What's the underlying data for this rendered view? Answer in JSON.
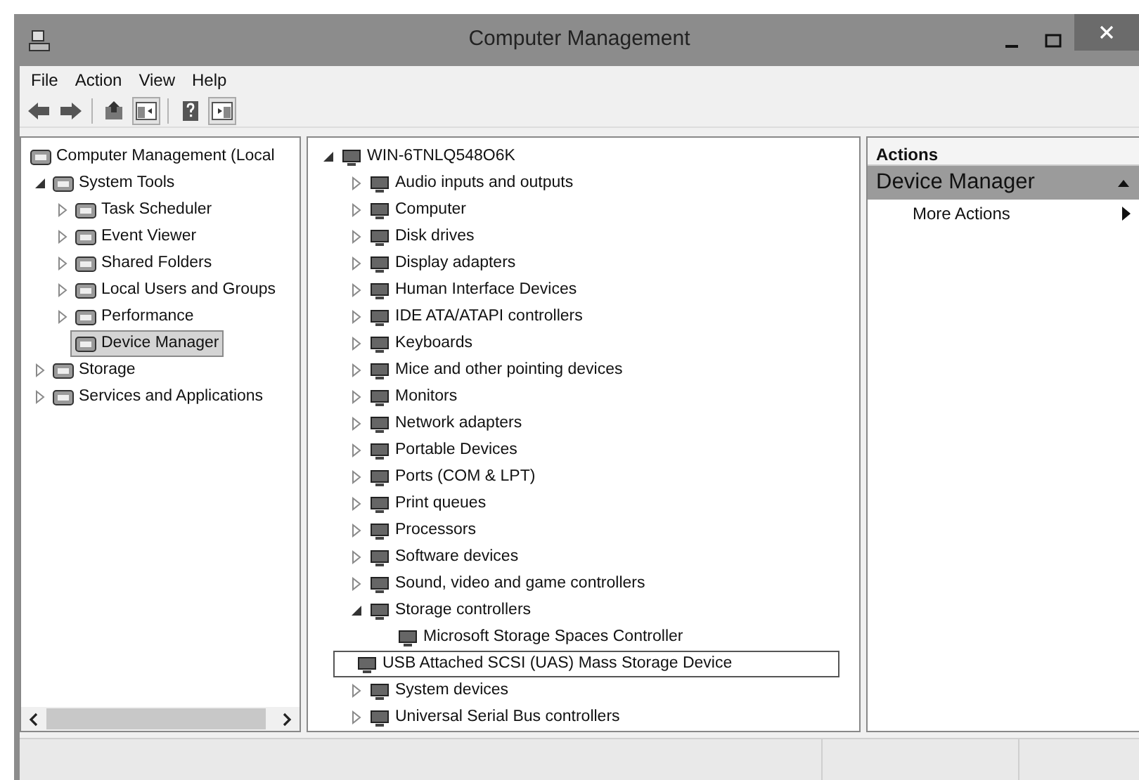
{
  "window": {
    "title": "Computer Management"
  },
  "menu": [
    "File",
    "Action",
    "View",
    "Help"
  ],
  "toolbar": [
    {
      "kind": "back",
      "pressed": false
    },
    {
      "kind": "forward",
      "pressed": false
    },
    {
      "kind": "separator"
    },
    {
      "kind": "up",
      "pressed": false
    },
    {
      "kind": "console_tree",
      "pressed": true
    },
    {
      "kind": "separator"
    },
    {
      "kind": "help",
      "pressed": false
    },
    {
      "kind": "action_pane",
      "pressed": true
    }
  ],
  "console_tree": {
    "items": [
      {
        "label": "Computer Management (Local",
        "selected": false,
        "children": [
          {
            "label": "System Tools",
            "expanded": true,
            "selected": false,
            "children": [
              {
                "label": "Task Scheduler",
                "expanded": false,
                "selected": false
              },
              {
                "label": "Event Viewer",
                "expanded": false,
                "selected": false
              },
              {
                "label": "Shared Folders",
                "expanded": false,
                "selected": false
              },
              {
                "label": "Local Users and Groups",
                "expanded": false,
                "selected": false
              },
              {
                "label": "Performance",
                "expanded": false,
                "selected": false
              },
              {
                "label": "Device Manager",
                "selected": true
              }
            ]
          },
          {
            "label": "Storage",
            "expanded": false,
            "selected": false
          },
          {
            "label": "Services and Applications",
            "expanded": false,
            "selected": false
          }
        ]
      }
    ]
  },
  "device_tree": {
    "items": [
      {
        "label": "WIN-6TNLQ548O6K",
        "expanded": true,
        "selected": false,
        "children": [
          {
            "label": "Audio inputs and outputs",
            "expanded": false,
            "selected": false
          },
          {
            "label": "Computer",
            "expanded": false,
            "selected": false
          },
          {
            "label": "Disk drives",
            "expanded": false,
            "selected": false
          },
          {
            "label": "Display adapters",
            "expanded": false,
            "selected": false
          },
          {
            "label": "Human Interface Devices",
            "expanded": false,
            "selected": false
          },
          {
            "label": "IDE ATA/ATAPI controllers",
            "expanded": false,
            "selected": false
          },
          {
            "label": "Keyboards",
            "expanded": false,
            "selected": false
          },
          {
            "label": "Mice and other pointing devices",
            "expanded": false,
            "selected": false
          },
          {
            "label": "Monitors",
            "expanded": false,
            "selected": false
          },
          {
            "label": "Network adapters",
            "expanded": false,
            "selected": false
          },
          {
            "label": "Portable Devices",
            "expanded": false,
            "selected": false
          },
          {
            "label": "Ports (COM & LPT)",
            "expanded": false,
            "selected": false
          },
          {
            "label": "Print queues",
            "expanded": false,
            "selected": false
          },
          {
            "label": "Processors",
            "expanded": false,
            "selected": false
          },
          {
            "label": "Software devices",
            "expanded": false,
            "selected": false
          },
          {
            "label": "Sound, video and game controllers",
            "expanded": false,
            "selected": false
          },
          {
            "label": "Storage controllers",
            "expanded": true,
            "selected": false,
            "children": [
              {
                "label": "Microsoft Storage Spaces Controller",
                "selected": false
              },
              {
                "label": "USB Attached SCSI (UAS) Mass Storage Device",
                "selected": true
              }
            ]
          },
          {
            "label": "System devices",
            "expanded": false,
            "selected": false
          },
          {
            "label": "Universal Serial Bus controllers",
            "expanded": false,
            "selected": false
          }
        ]
      }
    ]
  },
  "actions": {
    "title": "Actions",
    "section": {
      "title": "Device Manager",
      "expanded": true,
      "items": [
        {
          "label": "More Actions"
        }
      ]
    }
  }
}
